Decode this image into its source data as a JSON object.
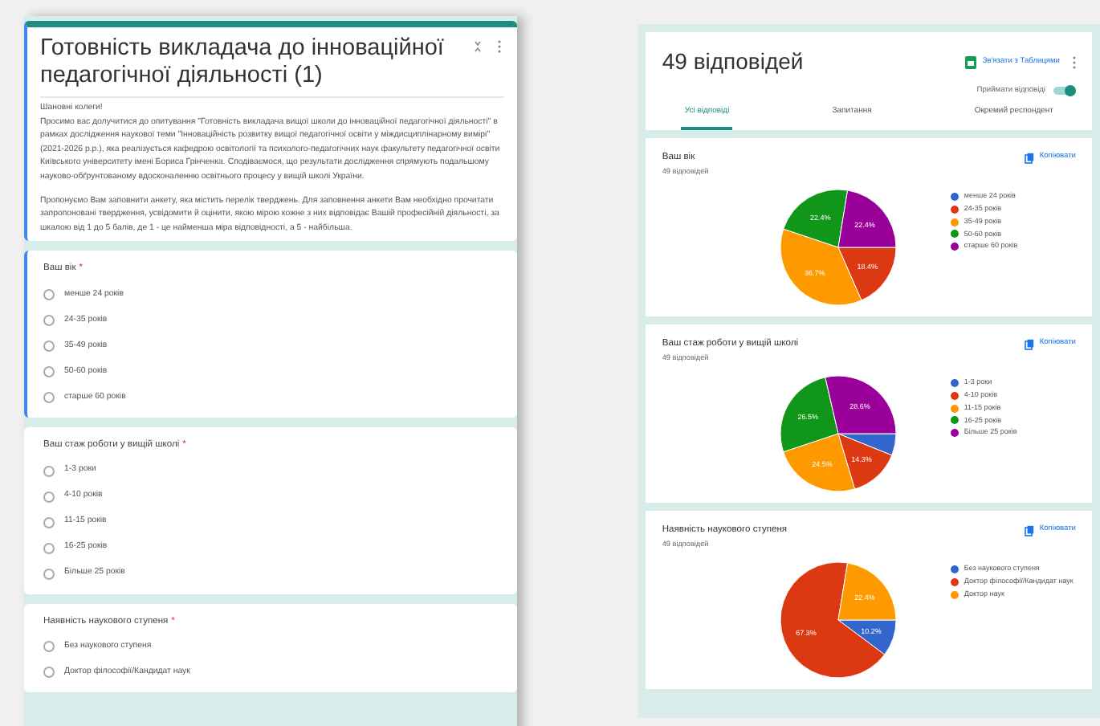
{
  "form_editor": {
    "title": "Готовність викладача до інноваційної педагогічної діяльності (1)",
    "greeting": "Шановні колеги!",
    "paragraphs": [
      "Просимо вас долучитися до опитування \"Готовність викладача вищої школи до інноваційної педагогічної діяльності\" в рамках дослідження наукової теми \"Інноваційність розвитку вищої педагогічної освіти у міждисциплінарному вимірі\" (2021-2026 р.р.), яка реалізується кафедрою освітології та психолого-педагогічних наук факультету педагогічної освіти Київського університету імені Бориса Грінченка. Сподіваємося, що результати дослідження спрямують подальшому науково-обґрунтованому вдосконаленню освітнього процесу у вищій школі України.",
      "Пропонуємо Вам заповнити анкету, яка містить перелік тверджень. Для заповнення анкети Вам необхідно прочитати запропоновані твердження, усвідомити й оцінити, якою мірою кожне з них відповідає Вашій професійній діяльності, за шкалою від 1 до 5 балів, де 1 - це найменша міра відповідності, а 5 - найбільша."
    ],
    "questions": [
      {
        "title": "Ваш вік",
        "required_mark": "*",
        "selected": true,
        "options": [
          {
            "label": "менше 24 років",
            "checked": false
          },
          {
            "label": "24-35 років",
            "checked": false
          },
          {
            "label": "35-49 років",
            "checked": false
          },
          {
            "label": "50-60 років",
            "checked": false
          },
          {
            "label": "старше 60 років",
            "checked": false
          }
        ]
      },
      {
        "title": "Ваш стаж роботи у вищій школі",
        "required_mark": "*",
        "selected": false,
        "options": [
          {
            "label": "1-3 роки",
            "checked": false
          },
          {
            "label": "4-10 років",
            "checked": false
          },
          {
            "label": "11-15 років",
            "checked": false
          },
          {
            "label": "16-25 років",
            "checked": false
          },
          {
            "label": "Більше 25 років",
            "checked": false
          }
        ]
      },
      {
        "title": "Наявність наукового ступеня",
        "required_mark": "*",
        "selected": false,
        "options": [
          {
            "label": "Без наукового ступеня",
            "checked": false
          },
          {
            "label": "Доктор філософії/Кандидат наук",
            "checked": false
          }
        ]
      }
    ]
  },
  "responses": {
    "count_title": "49 відповідей",
    "sheets_link": "Зв'язати з Таблицями",
    "accepting": {
      "label": "Приймати відповіді",
      "on": true
    },
    "tabs": [
      {
        "label": "Усі відповіді",
        "selected": true
      },
      {
        "label": "Запитання",
        "selected": false
      },
      {
        "label": "Окремий респондент",
        "selected": false
      }
    ],
    "cards": [
      {
        "title": "Ваш вік",
        "subtitle": "49 відповідей",
        "copy": "Копіювати",
        "chart_data": {
          "type": "pie",
          "categories": [
            "менше 24 років",
            "24-35 років",
            "35-49 років",
            "50-60 років",
            "старше 60 років"
          ],
          "values": [
            0,
            18.4,
            36.7,
            22.4,
            22.4
          ],
          "colors": [
            "#3366cc",
            "#dc3912",
            "#ff9900",
            "#109618",
            "#990099"
          ],
          "value_labels": [
            null,
            "18.4%",
            "36.7%",
            "22.4%",
            "22.4%"
          ]
        }
      },
      {
        "title": "Ваш стаж роботи у вищій школі",
        "subtitle": "49 відповідей",
        "copy": "Копіювати",
        "chart_data": {
          "type": "pie",
          "categories": [
            "1-3 роки",
            "4-10 років",
            "11-15 років",
            "16-25 років",
            "Більше 25 років"
          ],
          "values": [
            6.1,
            14.3,
            24.5,
            26.5,
            28.6
          ],
          "colors": [
            "#3366cc",
            "#dc3912",
            "#ff9900",
            "#109618",
            "#990099"
          ],
          "value_labels": [
            null,
            "14.3%",
            "24.5%",
            "26.5%",
            "28.6%"
          ]
        }
      },
      {
        "title": "Наявність наукового ступеня",
        "subtitle": "49 відповідей",
        "copy": "Копіювати",
        "chart_data": {
          "type": "pie",
          "categories": [
            "Без наукового ступеня",
            "Доктор філософії/Кандидат наук",
            "Доктор наук"
          ],
          "values": [
            10.2,
            67.3,
            22.4
          ],
          "colors": [
            "#3366cc",
            "#dc3912",
            "#ff9900"
          ],
          "value_labels": [
            "10.2%",
            "67.3%",
            "22.4%"
          ]
        }
      }
    ]
  }
}
